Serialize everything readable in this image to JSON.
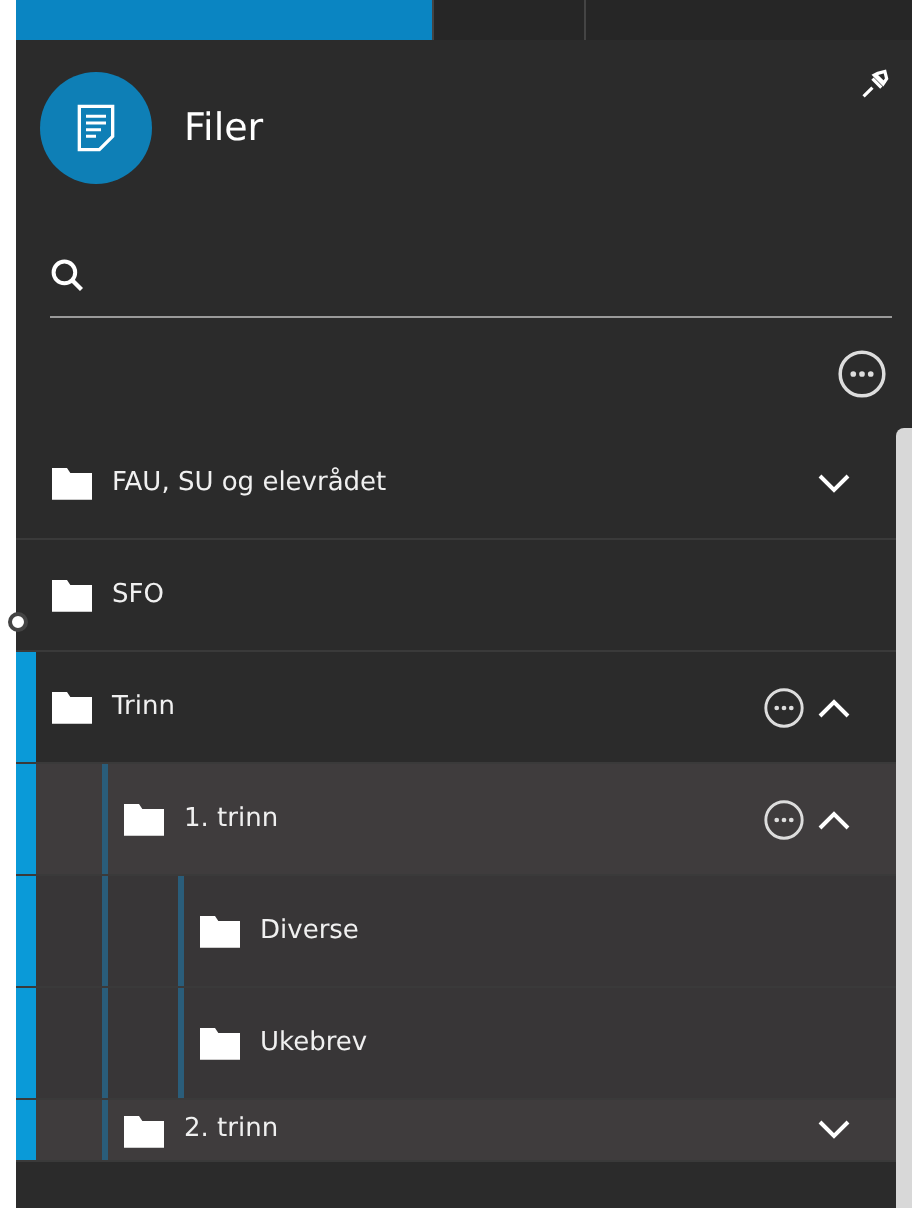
{
  "panel": {
    "title": "Filer"
  },
  "tree": [
    {
      "label": "FAU, SU og elevrådet",
      "expanded": false
    },
    {
      "label": "SFO"
    },
    {
      "label": "Trinn",
      "expanded": true,
      "menu": true,
      "children": [
        {
          "label": "1. trinn",
          "expanded": true,
          "menu": true,
          "children": [
            {
              "label": "Diverse"
            },
            {
              "label": "Ukebrev"
            }
          ]
        },
        {
          "label": "2. trinn",
          "expanded": false
        }
      ]
    }
  ]
}
